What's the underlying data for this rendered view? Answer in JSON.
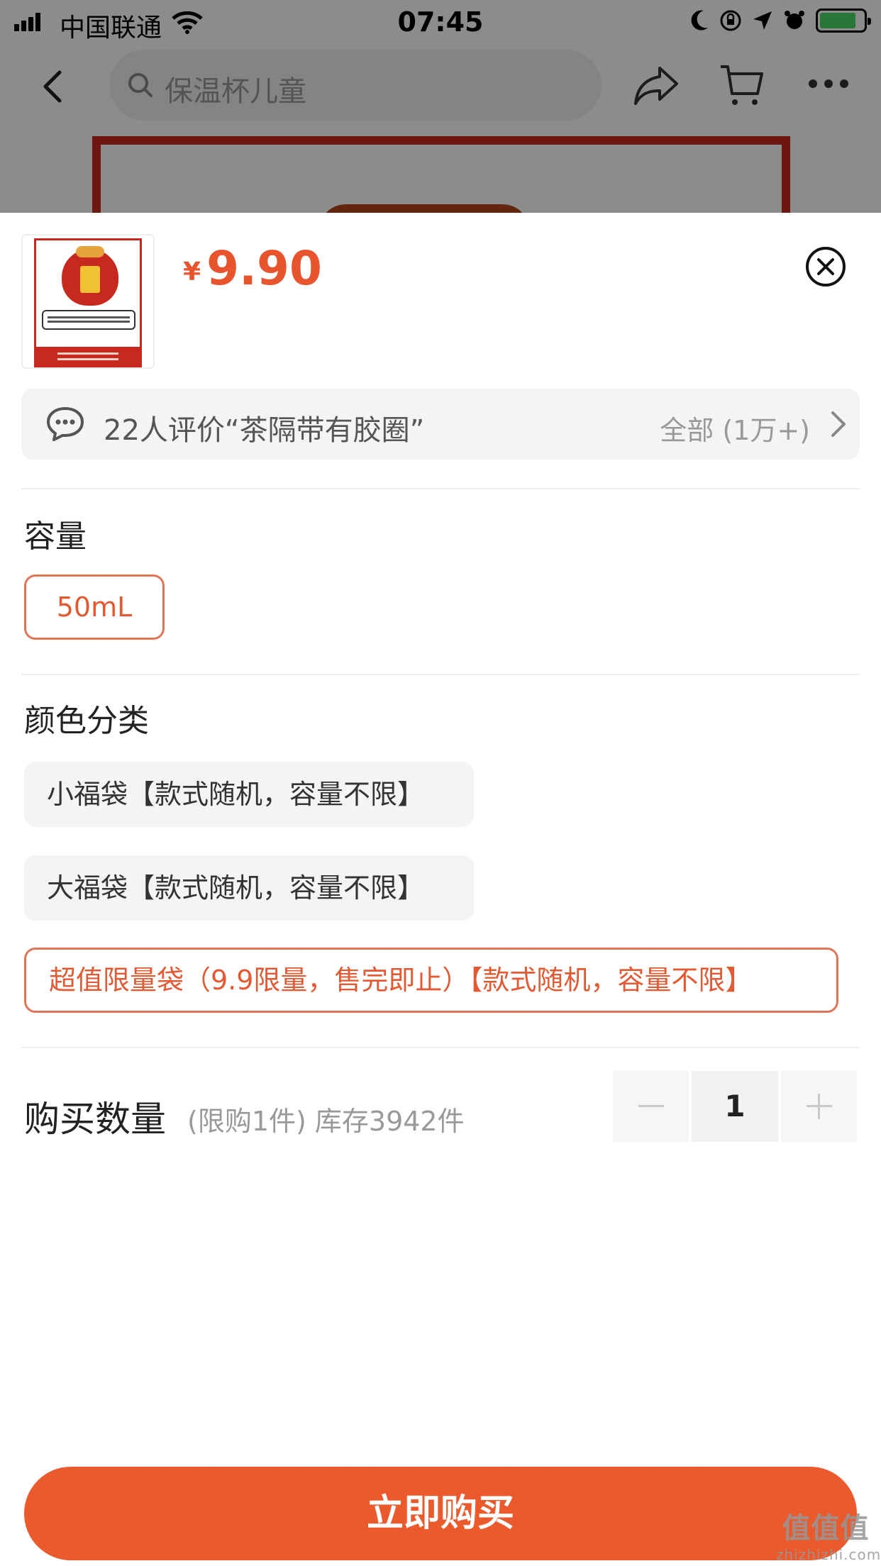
{
  "status_bar": {
    "carrier": "中国联通",
    "time": "07:45"
  },
  "nav": {
    "search_text": "保温杯儿童"
  },
  "product": {
    "currency": "¥",
    "price": "9.90"
  },
  "reviews": {
    "summary": "22人评价“茶隔带有胶圈”",
    "all_label": "全部 (1万+)"
  },
  "capacity": {
    "title": "容量",
    "options": [
      {
        "label": "50mL",
        "selected": true
      }
    ]
  },
  "color": {
    "title": "颜色分类",
    "options": [
      {
        "label": "小福袋【款式随机，容量不限】",
        "selected": false
      },
      {
        "label": "大福袋【款式随机，容量不限】",
        "selected": false
      },
      {
        "label": "超值限量袋（9.9限量，售完即止）【款式随机，容量不限】",
        "selected": true
      }
    ]
  },
  "quantity": {
    "label": "购买数量",
    "note": "(限购1件) 库存3942件",
    "value": "1"
  },
  "buy_button": {
    "label": "立即购买"
  },
  "watermark": {
    "top": "值值值",
    "bottom": "zhizhizhi.com"
  },
  "colors": {
    "accent": "#ea5a2d",
    "selected_border": "#e07558",
    "chip_bg": "#f4f4f4"
  },
  "icons": [
    "signal-icon",
    "wifi-icon",
    "moon-icon",
    "battery-icon",
    "back-icon",
    "search-icon",
    "share-icon",
    "cart-icon",
    "more-icon",
    "close-icon",
    "chat-bubble-icon",
    "chevron-right-icon",
    "minus-icon",
    "plus-icon"
  ]
}
